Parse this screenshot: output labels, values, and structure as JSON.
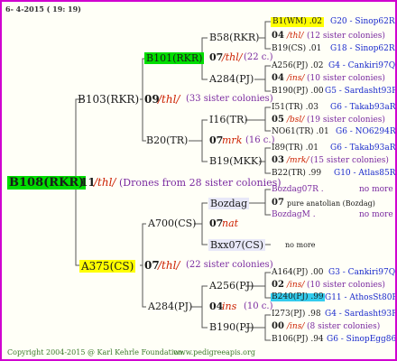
{
  "header": {
    "date": "6- 4-2015 ( 19: 19)"
  },
  "footer": {
    "copyright": "Copyright 2004-2015 @ Karl Kehrle Foundation.",
    "site": "www.pedigreeapis.org"
  },
  "colors": {
    "border": "#d000d0",
    "green": "#00dd00",
    "yellow": "#ffff00",
    "cyan": "#33ccee"
  },
  "root": {
    "name": "B108(RKR)",
    "num": "11",
    "sym": "/thl/",
    "note": "(Drones from 28 sister colonies)"
  },
  "p1": {
    "name": "B103(RKR)",
    "num": "09",
    "sym": "/thl/",
    "note": "(33 sister colonies)"
  },
  "p2": {
    "name": "A375(CS)",
    "num": "07",
    "sym": "/thl/",
    "note": "(22 sister colonies)"
  },
  "g1": {
    "name": "B101(RKR)",
    "num": "07",
    "sym": "/thl/",
    "note": "(22 c.)"
  },
  "g2": {
    "name": "B20(TR)",
    "num": "07",
    "sym": "mrk",
    "note": "(16 c.)"
  },
  "g3": {
    "name": "A700(CS)",
    "num": "07",
    "sym": "nat"
  },
  "g4": {
    "name": "A284(PJ)",
    "num": "04",
    "sym": "ins",
    "note": "(10 c.)"
  },
  "gg": {
    "b58": "B58(RKR)",
    "a284": "A284(PJ)",
    "i16": "I16(TR)",
    "b19": "B19(MKK)",
    "bozdag": "Bozdag",
    "bxx07": "Bxx07(CS)",
    "a256": "A256(PJ)",
    "b190": "B190(PJ)"
  },
  "right": [
    {
      "a": "B1(WM) .02",
      "b": "G20 - Sinop62R"
    },
    {
      "num": "04",
      "sym": "/thl/",
      "note": "(12 sister colonies)"
    },
    {
      "a": "B19(CS) .01",
      "b": "G18 - Sinop62R"
    },
    {
      "a": "A256(PJ) .02",
      "b": "G4 - Cankiri97Q"
    },
    {
      "num": "04",
      "sym": "/ins/",
      "note": "(10 sister colonies)"
    },
    {
      "a": "B190(PJ) .00",
      "b": "G5 - Sardasht93R"
    },
    {
      "a": "I51(TR) .03",
      "b": "G6 - Takab93aR"
    },
    {
      "num": "05",
      "sym": "/bsl/",
      "note": "(19 sister colonies)"
    },
    {
      "a": "NO61(TR) .01",
      "b": "G6 - NO6294R"
    },
    {
      "a": "I89(TR) .01",
      "b": "G6 - Takab93aR"
    },
    {
      "num": "03",
      "sym": "/mrk/",
      "note": "(15 sister colonies)"
    },
    {
      "a": "B22(TR) .99",
      "b": "G10 - Atlas85R"
    },
    {
      "a": "Bozdag07R .",
      "b": "no more"
    },
    {
      "num": "07",
      "note": "pure anatolian (Bozdag)"
    },
    {
      "a": "BozdagM .",
      "b": "no more"
    },
    {
      "a": "no more"
    },
    {
      "a": "A164(PJ) .00",
      "b": "G3 - Cankiri97Q"
    },
    {
      "num": "02",
      "sym": "/ins/",
      "note": "(10 sister colonies)"
    },
    {
      "a": "B240(PJ) .99",
      "b": "G11 - AthosSt80R"
    },
    {
      "a": "I273(PJ) .98",
      "b": "G4 - Sardasht93R"
    },
    {
      "num": "00",
      "sym": "/ins/",
      "note": "(8 sister colonies)"
    },
    {
      "a": "B106(PJ) .94",
      "b": "G6 - SinopEgg86R"
    }
  ]
}
